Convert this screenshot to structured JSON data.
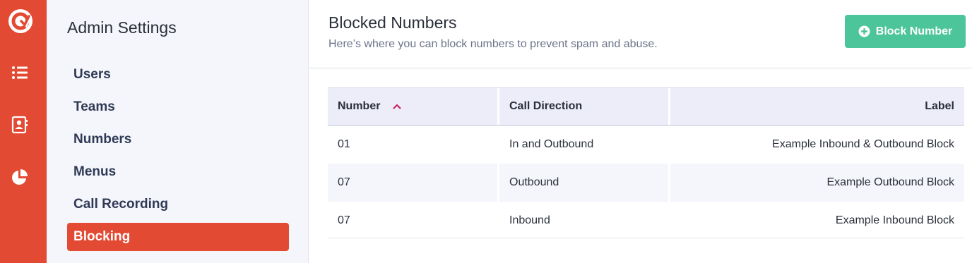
{
  "colors": {
    "brand": "#e34a33",
    "accent_button": "#4cc59a",
    "header_bg": "#ecedf8",
    "sort_arrow": "#c6195a"
  },
  "rail": {
    "icons": [
      "logo-icon",
      "list-icon",
      "contact-book-icon",
      "pie-chart-icon"
    ]
  },
  "sidebar": {
    "title": "Admin Settings",
    "items": [
      {
        "label": "Users"
      },
      {
        "label": "Teams"
      },
      {
        "label": "Numbers"
      },
      {
        "label": "Menus"
      },
      {
        "label": "Call Recording"
      },
      {
        "label": "Blocking",
        "active": true
      }
    ]
  },
  "header": {
    "title": "Blocked Numbers",
    "subtitle": "Here’s where you can block numbers to prevent spam and abuse.",
    "button_label": "Block Number"
  },
  "table": {
    "columns": [
      "Number",
      "Call Direction",
      "Label"
    ],
    "sorted_by": "Number",
    "sort_direction": "ascending",
    "rows": [
      {
        "number": "01",
        "direction": "In and Outbound",
        "label": "Example Inbound & Outbound Block"
      },
      {
        "number": "07",
        "direction": "Outbound",
        "label": "Example Outbound Block"
      },
      {
        "number": "07",
        "direction": "Inbound",
        "label": "Example Inbound Block"
      }
    ]
  }
}
